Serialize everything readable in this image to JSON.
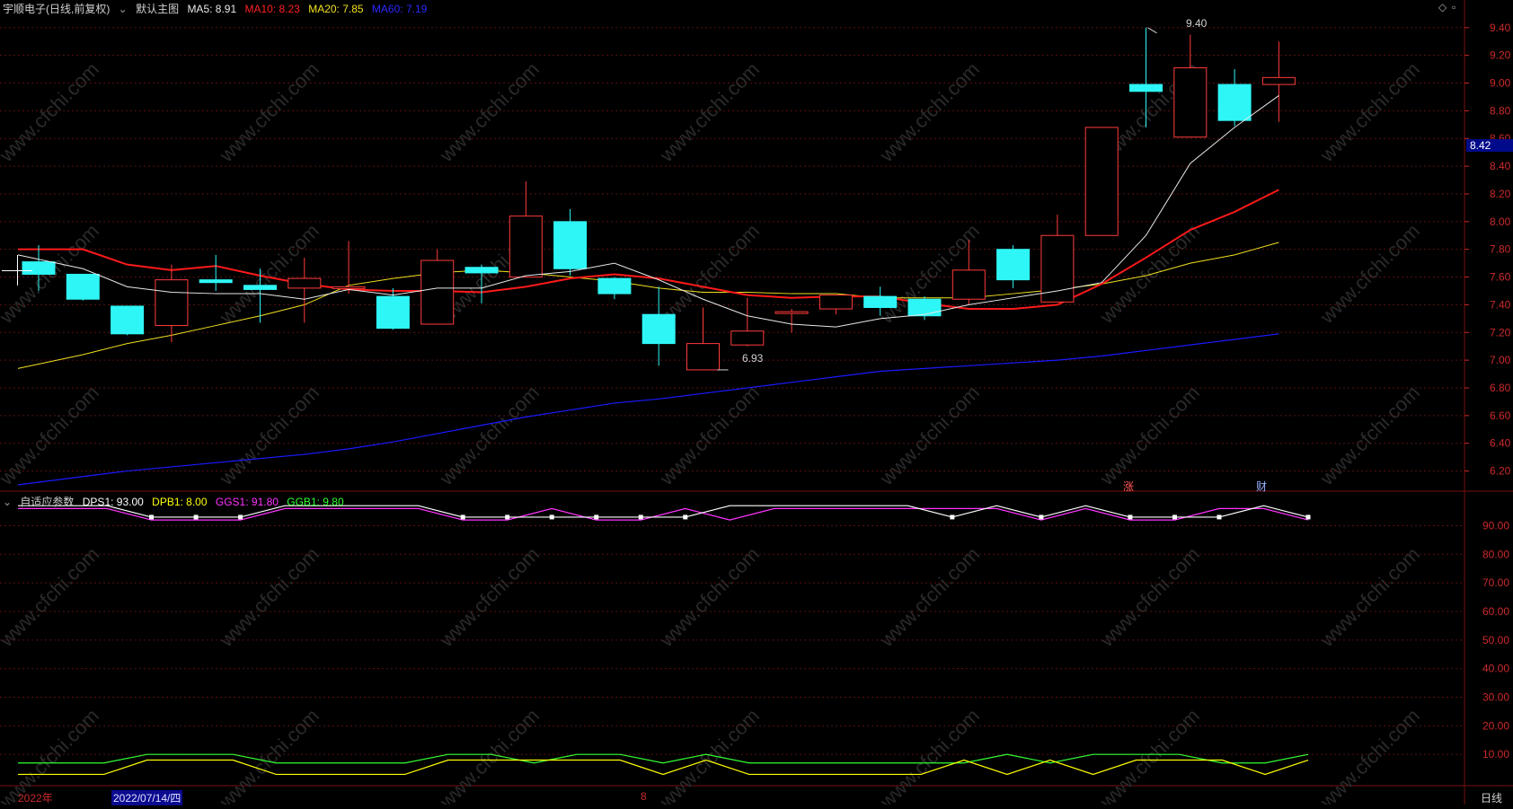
{
  "header": {
    "stock_title": "宇顺电子(日线,前复权)",
    "template_label": "默认主图",
    "ma5": "MA5: 8.91",
    "ma10": "MA10: 8.23",
    "ma20": "MA20: 7.85",
    "ma60": "MA60: 7.19"
  },
  "colors": {
    "up": "#ff3b3b",
    "down": "#2ef6f6",
    "ma5": "#e8e8e8",
    "ma10": "#ff1a1a",
    "ma20": "#f0e020",
    "ma60": "#1a1aff",
    "grid": "#5a1010",
    "axis_text": "#cc2a2a",
    "dps1": "#ffffff",
    "dpb1": "#ffff00",
    "ggs1": "#ff33ff",
    "ggb1": "#33ff33",
    "price_tag_bg": "#000a8a"
  },
  "right_icons": {
    "diamond": "◇",
    "square": "▫"
  },
  "price_axis": {
    "ticks": [
      "9.40",
      "9.20",
      "9.00",
      "8.80",
      "8.60",
      "8.40",
      "8.20",
      "8.00",
      "7.80",
      "7.60",
      "7.40",
      "7.20",
      "7.00",
      "6.80",
      "6.60",
      "6.40",
      "6.20"
    ],
    "current_price": "8.42"
  },
  "annotations": {
    "high": "9.40",
    "low": "6.93",
    "badge_rise": "涨",
    "badge_finance": "财"
  },
  "indicator": {
    "name": "自适应参数",
    "dps1": "DPS1: 93.00",
    "dpb1": "DPB1: 8.00",
    "ggs1": "GGS1: 91.80",
    "ggb1": "GGB1: 9.80",
    "ticks": [
      "90.00",
      "80.00",
      "70.00",
      "60.00",
      "50.00",
      "40.00",
      "30.00",
      "20.00",
      "10.00"
    ]
  },
  "bottom_bar": {
    "year_label": "2022年",
    "date_label": "2022/07/14/四",
    "month_label": "8",
    "period_label": "日线"
  },
  "watermark": "www.cfchi.com",
  "chart_data": {
    "type": "candlestick",
    "price_range": [
      6.1,
      9.47
    ],
    "candles": [
      {
        "o": 7.71,
        "h": 7.83,
        "l": 7.5,
        "c": 7.62
      },
      {
        "o": 7.62,
        "h": 7.62,
        "l": 7.43,
        "c": 7.44
      },
      {
        "o": 7.39,
        "h": 7.39,
        "l": 7.18,
        "c": 7.19
      },
      {
        "o": 7.25,
        "h": 7.69,
        "l": 7.13,
        "c": 7.58
      },
      {
        "o": 7.58,
        "h": 7.76,
        "l": 7.5,
        "c": 7.56
      },
      {
        "o": 7.54,
        "h": 7.66,
        "l": 7.27,
        "c": 7.51
      },
      {
        "o": 7.52,
        "h": 7.74,
        "l": 7.27,
        "c": 7.59
      },
      {
        "o": 7.52,
        "h": 7.86,
        "l": 7.48,
        "c": 7.53
      },
      {
        "o": 7.46,
        "h": 7.52,
        "l": 7.22,
        "c": 7.23
      },
      {
        "o": 7.26,
        "h": 7.8,
        "l": 7.26,
        "c": 7.72
      },
      {
        "o": 7.67,
        "h": 7.69,
        "l": 7.41,
        "c": 7.63
      },
      {
        "o": 7.6,
        "h": 8.29,
        "l": 7.6,
        "c": 8.04
      },
      {
        "o": 8.0,
        "h": 8.09,
        "l": 7.61,
        "c": 7.66
      },
      {
        "o": 7.59,
        "h": 7.6,
        "l": 7.44,
        "c": 7.48
      },
      {
        "o": 7.33,
        "h": 7.53,
        "l": 6.96,
        "c": 7.12
      },
      {
        "o": 6.93,
        "h": 7.38,
        "l": 6.93,
        "c": 7.12
      },
      {
        "o": 7.11,
        "h": 7.45,
        "l": 7.1,
        "c": 7.21
      },
      {
        "o": 7.34,
        "h": 7.37,
        "l": 7.2,
        "c": 7.35
      },
      {
        "o": 7.37,
        "h": 7.47,
        "l": 7.33,
        "c": 7.47
      },
      {
        "o": 7.46,
        "h": 7.53,
        "l": 7.32,
        "c": 7.38
      },
      {
        "o": 7.44,
        "h": 7.46,
        "l": 7.29,
        "c": 7.32
      },
      {
        "o": 7.44,
        "h": 7.87,
        "l": 7.4,
        "c": 7.65
      },
      {
        "o": 7.8,
        "h": 7.83,
        "l": 7.52,
        "c": 7.58
      },
      {
        "o": 7.42,
        "h": 8.05,
        "l": 7.42,
        "c": 7.9
      },
      {
        "o": 7.9,
        "h": 8.68,
        "l": 7.9,
        "c": 8.68
      },
      {
        "o": 8.99,
        "h": 9.4,
        "l": 8.68,
        "c": 8.94
      },
      {
        "o": 8.61,
        "h": 9.35,
        "l": 8.61,
        "c": 9.11
      },
      {
        "o": 8.99,
        "h": 9.1,
        "l": 8.69,
        "c": 8.73
      },
      {
        "o": 8.99,
        "h": 9.3,
        "l": 8.72,
        "c": 9.04
      }
    ],
    "ma5": [
      7.76,
      7.66,
      7.53,
      7.49,
      7.48,
      7.48,
      7.44,
      7.51,
      7.47,
      7.52,
      7.52,
      7.61,
      7.64,
      7.7,
      7.58,
      7.44,
      7.32,
      7.26,
      7.24,
      7.3,
      7.33,
      7.4,
      7.45,
      7.5,
      7.56,
      7.9,
      8.42,
      8.68,
      8.91
    ],
    "ma10": [
      7.8,
      7.8,
      7.69,
      7.65,
      7.68,
      7.61,
      7.55,
      7.51,
      7.5,
      7.5,
      7.49,
      7.53,
      7.59,
      7.62,
      7.59,
      7.53,
      7.47,
      7.45,
      7.46,
      7.46,
      7.41,
      7.37,
      7.37,
      7.4,
      7.55,
      7.74,
      7.94,
      8.07,
      8.23
    ],
    "ma20": [
      6.94,
      7.04,
      7.12,
      7.18,
      7.25,
      7.32,
      7.4,
      7.54,
      7.59,
      7.63,
      7.65,
      7.63,
      7.6,
      7.57,
      7.52,
      7.49,
      7.49,
      7.48,
      7.48,
      7.45,
      7.45,
      7.45,
      7.48,
      7.51,
      7.55,
      7.61,
      7.7,
      7.76,
      7.85
    ],
    "ma60": [
      6.1,
      6.16,
      6.2,
      6.23,
      6.26,
      6.29,
      6.32,
      6.36,
      6.41,
      6.47,
      6.53,
      6.59,
      6.64,
      6.69,
      6.72,
      6.76,
      6.8,
      6.84,
      6.88,
      6.92,
      6.94,
      6.96,
      6.98,
      7.0,
      7.03,
      7.07,
      7.11,
      7.15,
      7.19
    ],
    "indicator_range": [
      0,
      98
    ],
    "dps1": [
      97,
      97,
      97,
      93,
      93,
      93,
      97,
      97,
      97,
      97,
      93,
      93,
      93,
      93,
      93,
      93,
      97,
      97,
      97,
      97,
      97,
      93,
      97,
      93,
      97,
      93,
      93,
      93,
      97,
      93
    ],
    "ggs1": [
      96,
      96,
      96,
      92,
      92,
      92,
      96,
      96,
      96,
      96,
      92,
      92,
      96,
      92,
      92,
      96,
      92,
      96,
      96,
      96,
      96,
      96,
      96,
      92,
      96,
      92,
      92,
      96,
      96,
      92
    ],
    "dpb1": [
      3,
      3,
      3,
      8,
      8,
      8,
      3,
      3,
      3,
      3,
      8,
      8,
      8,
      8,
      8,
      3,
      8,
      3,
      3,
      3,
      3,
      3,
      8,
      3,
      8,
      3,
      8,
      8,
      8,
      3,
      8
    ],
    "ggb1": [
      7,
      7,
      7,
      10,
      10,
      10,
      7,
      7,
      7,
      7,
      10,
      10,
      7,
      10,
      10,
      7,
      10,
      7,
      7,
      7,
      7,
      7,
      7,
      10,
      7,
      10,
      10,
      10,
      7,
      7,
      10
    ]
  }
}
